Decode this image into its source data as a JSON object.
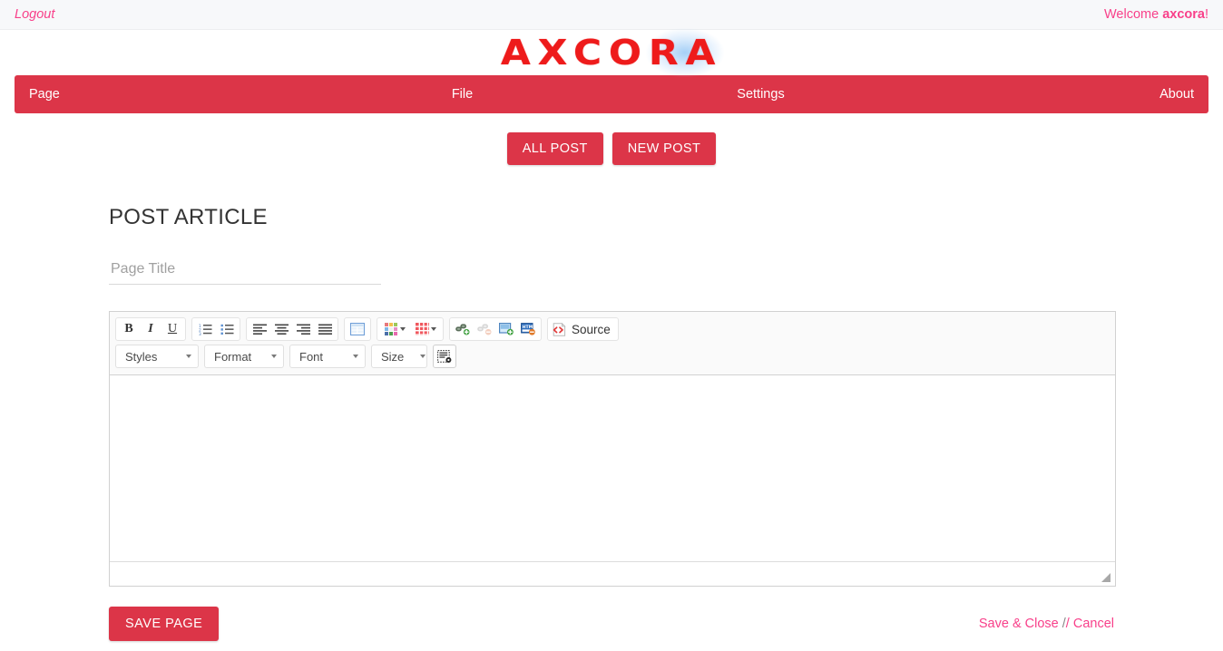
{
  "topbar": {
    "logout_label": "Logout",
    "welcome_prefix": "Welcome ",
    "welcome_user": "axcora",
    "welcome_suffix": "!"
  },
  "brand": {
    "logo_text": "AXCORA"
  },
  "nav": {
    "items": [
      {
        "label": "Page"
      },
      {
        "label": "File"
      },
      {
        "label": "Settings"
      },
      {
        "label": "About"
      }
    ],
    "bar_color": "#dc3548"
  },
  "actions": {
    "all_post_label": "ALL POST",
    "new_post_label": "NEW POST"
  },
  "main": {
    "heading": "POST ARTICLE",
    "title_input": {
      "value": "",
      "placeholder": "Page Title"
    }
  },
  "editor": {
    "toolbar_row1": [
      {
        "name": "bold-icon",
        "tip": "Bold"
      },
      {
        "name": "italic-icon",
        "tip": "Italic"
      },
      {
        "name": "underline-icon",
        "tip": "Underline"
      },
      {
        "name": "numbered-list-icon",
        "tip": "Insert/Remove Numbered List"
      },
      {
        "name": "bulleted-list-icon",
        "tip": "Insert/Remove Bulleted List"
      },
      {
        "name": "align-left-icon",
        "tip": "Align Left"
      },
      {
        "name": "align-center-icon",
        "tip": "Center"
      },
      {
        "name": "align-right-icon",
        "tip": "Align Right"
      },
      {
        "name": "justify-icon",
        "tip": "Justify"
      },
      {
        "name": "table-icon",
        "tip": "Table"
      },
      {
        "name": "text-color-icon",
        "tip": "Text Color"
      },
      {
        "name": "background-color-icon",
        "tip": "Background Color"
      },
      {
        "name": "link-icon",
        "tip": "Link"
      },
      {
        "name": "unlink-icon",
        "tip": "Unlink"
      },
      {
        "name": "image-icon",
        "tip": "Image"
      },
      {
        "name": "html-template-icon",
        "tip": "Templates"
      }
    ],
    "source_label": "Source",
    "toolbar_row2": [
      {
        "label": "Styles"
      },
      {
        "label": "Format"
      },
      {
        "label": "Font"
      },
      {
        "label": "Size"
      }
    ],
    "show_blocks_icon": "show-blocks-icon",
    "body_value": "",
    "resize_grip": "resize-grip-icon"
  },
  "footer": {
    "save_page_label": "SAVE PAGE",
    "save_close_label": "Save & Close",
    "separator_1": "/",
    "separator_2": "/",
    "cancel_label": "Cancel"
  },
  "colors": {
    "brand_red": "#dc3548",
    "link_pink": "#f8408a",
    "logo_red": "#ee1b1b"
  }
}
